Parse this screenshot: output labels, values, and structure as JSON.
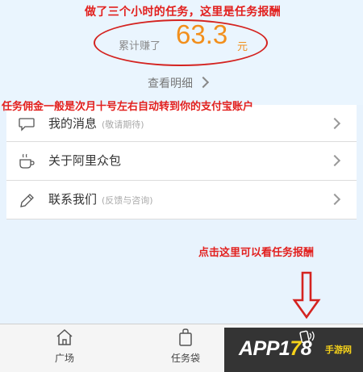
{
  "annotations": {
    "top": "做了三个小时的任务，这里是任务报酬",
    "middle": "任务佣金一般是次月十号左右自动转到你的支付宝账户",
    "bottom": "点击这里可以看任务报酬"
  },
  "earnings": {
    "label": "累计赚了",
    "amount": "63.3",
    "unit": "元",
    "detail_link": "查看明细"
  },
  "menu": {
    "items": [
      {
        "label": "我的消息",
        "sub": "(敬请期待)",
        "icon": "chat-bubble-icon"
      },
      {
        "label": "关于阿里众包",
        "sub": "",
        "icon": "coffee-cup-icon"
      },
      {
        "label": "联系我们",
        "sub": "(反馈与咨询)",
        "icon": "pencil-icon"
      }
    ]
  },
  "tabbar": {
    "tabs": [
      {
        "label": "广场",
        "icon": "home-icon"
      },
      {
        "label": "任务袋",
        "icon": "bag-icon"
      },
      {
        "label": "",
        "icon": "phone-icon"
      }
    ]
  },
  "watermark": {
    "text_prefix": "APP",
    "text_num1": "1",
    "text_num2": "7",
    "text_num3": "8",
    "text_cn": "手游网"
  },
  "colors": {
    "annotation": "#e2201e",
    "amount": "#f28f1c",
    "background": "#e8f3fd"
  }
}
